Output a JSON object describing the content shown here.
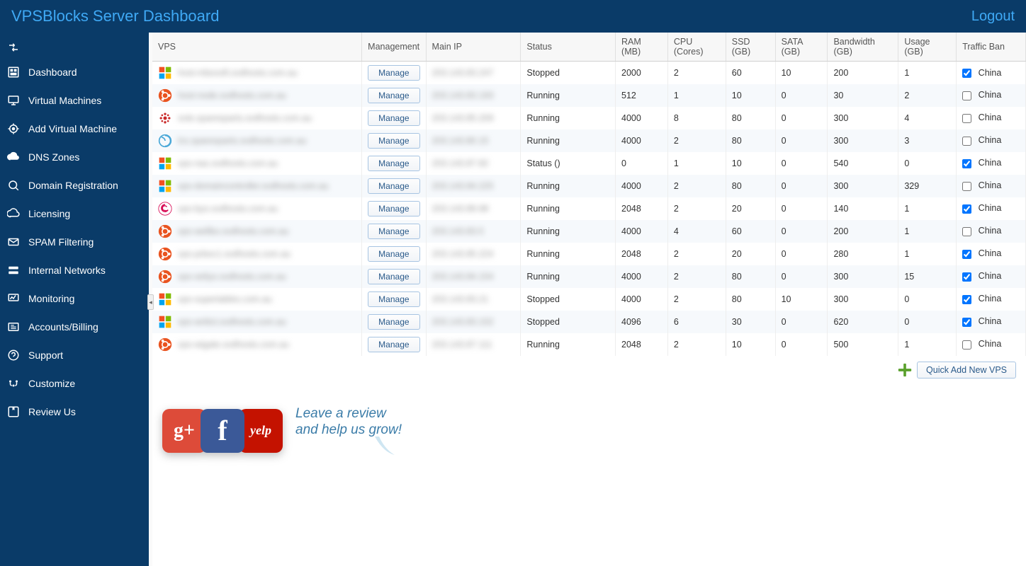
{
  "header": {
    "title": "VPSBlocks Server Dashboard",
    "logout": "Logout"
  },
  "sidebar": {
    "items": [
      {
        "icon": "dashboard",
        "label": "Dashboard"
      },
      {
        "icon": "vm",
        "label": "Virtual Machines"
      },
      {
        "icon": "add-vm",
        "label": "Add Virtual Machine"
      },
      {
        "icon": "dns",
        "label": "DNS Zones"
      },
      {
        "icon": "domain",
        "label": "Domain Registration"
      },
      {
        "icon": "licensing",
        "label": "Licensing"
      },
      {
        "icon": "spam",
        "label": "SPAM Filtering"
      },
      {
        "icon": "network",
        "label": "Internal Networks"
      },
      {
        "icon": "monitor",
        "label": "Monitoring"
      },
      {
        "icon": "billing",
        "label": "Accounts/Billing"
      },
      {
        "icon": "support",
        "label": "Support"
      },
      {
        "icon": "customize",
        "label": "Customize"
      },
      {
        "icon": "review",
        "label": "Review Us"
      }
    ]
  },
  "table": {
    "columns": [
      "VPS",
      "Management",
      "Main IP",
      "Status",
      "RAM (MB)",
      "CPU (Cores)",
      "SSD (GB)",
      "SATA (GB)",
      "Bandwidth (GB)",
      "Usage (GB)",
      "Traffic Ban"
    ],
    "manage_label": "Manage",
    "ban_label": "China",
    "rows": [
      {
        "os": "windows",
        "vps": "host-mboxsft.svdhosts.com.au",
        "ip": "203.143.83.247",
        "status": "Stopped",
        "ram": "2000",
        "cpu": "2",
        "ssd": "60",
        "sata": "10",
        "bw": "200",
        "usage": "1",
        "ban": true
      },
      {
        "os": "ubuntu",
        "vps": "host-node.svdhosts.com.au",
        "ip": "203.143.83.193",
        "status": "Running",
        "ram": "512",
        "cpu": "1",
        "ssd": "10",
        "sata": "0",
        "bw": "30",
        "usage": "2",
        "ban": false
      },
      {
        "os": "dots",
        "vps": "svte.sparesparts.svdhosts.com.au",
        "ip": "203.143.85.209",
        "status": "Running",
        "ram": "4000",
        "cpu": "8",
        "ssd": "80",
        "sata": "0",
        "bw": "300",
        "usage": "4",
        "ban": false
      },
      {
        "os": "swirl",
        "vps": "lcs.sparesparts.svdhosts.com.au",
        "ip": "203.143.80.15",
        "status": "Running",
        "ram": "4000",
        "cpu": "2",
        "ssd": "80",
        "sata": "0",
        "bw": "300",
        "usage": "3",
        "ban": false
      },
      {
        "os": "windows",
        "vps": "vps-nas.svdhosts.com.au",
        "ip": "203.143.87.82",
        "status": "Status ()",
        "ram": "0",
        "cpu": "1",
        "ssd": "10",
        "sata": "0",
        "bw": "540",
        "usage": "0",
        "ban": true
      },
      {
        "os": "windows",
        "vps": "vps-domaincontroller.svdhosts.com.au",
        "ip": "203.143.84.225",
        "status": "Running",
        "ram": "4000",
        "cpu": "2",
        "ssd": "80",
        "sata": "0",
        "bw": "300",
        "usage": "329",
        "ban": false
      },
      {
        "os": "debian",
        "vps": "vps-byo.svdhosts.com.au",
        "ip": "203.143.89.98",
        "status": "Running",
        "ram": "2048",
        "cpu": "2",
        "ssd": "20",
        "sata": "0",
        "bw": "140",
        "usage": "1",
        "ban": true
      },
      {
        "os": "ubuntu",
        "vps": "vps-wellbo.svdhosts.com.au",
        "ip": "203.143.83.5",
        "status": "Running",
        "ram": "4000",
        "cpu": "4",
        "ssd": "60",
        "sata": "0",
        "bw": "200",
        "usage": "1",
        "ban": false
      },
      {
        "os": "ubuntu",
        "vps": "vps-prboc1.svdhosts.com.au",
        "ip": "203.143.85.224",
        "status": "Running",
        "ram": "2048",
        "cpu": "2",
        "ssd": "20",
        "sata": "0",
        "bw": "280",
        "usage": "1",
        "ban": true
      },
      {
        "os": "ubuntu",
        "vps": "vps-seliyo.svdhosts.com.au",
        "ip": "203.143.84.154",
        "status": "Running",
        "ram": "4000",
        "cpu": "2",
        "ssd": "80",
        "sata": "0",
        "bw": "300",
        "usage": "15",
        "ban": true
      },
      {
        "os": "windows",
        "vps": "vps-supertables.com.au",
        "ip": "203.143.83.21",
        "status": "Stopped",
        "ram": "4000",
        "cpu": "2",
        "ssd": "80",
        "sata": "10",
        "bw": "300",
        "usage": "0",
        "ban": true
      },
      {
        "os": "windows",
        "vps": "vps-writict.svdhosts.com.au",
        "ip": "203.143.83.152",
        "status": "Stopped",
        "ram": "4096",
        "cpu": "6",
        "ssd": "30",
        "sata": "0",
        "bw": "620",
        "usage": "0",
        "ban": true
      },
      {
        "os": "ubuntu",
        "vps": "vps-wigate.svdhosts.com.au",
        "ip": "203.143.87.111",
        "status": "Running",
        "ram": "2048",
        "cpu": "2",
        "ssd": "10",
        "sata": "0",
        "bw": "500",
        "usage": "1",
        "ban": false
      }
    ]
  },
  "footer": {
    "quick_add_label": "Quick Add New VPS"
  },
  "review": {
    "line1": "Leave a review",
    "line2": "and help us grow!"
  },
  "os_colors": {
    "windows": "win",
    "ubuntu": "ubu",
    "debian": "deb",
    "dots": "dots",
    "swirl": "swirl"
  }
}
